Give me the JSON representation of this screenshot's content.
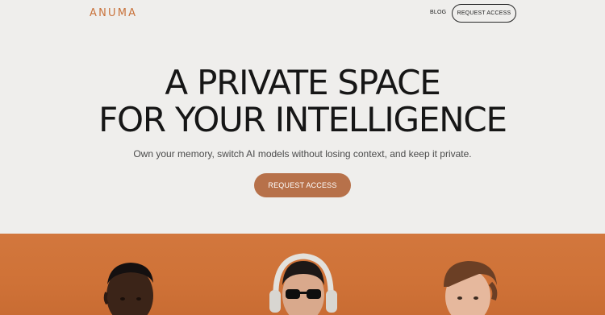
{
  "nav": {
    "logo": "ANUMA",
    "blog_label": "BLOG",
    "request_access_label": "REQUEST ACCESS"
  },
  "hero": {
    "title_line1": "A PRIVATE SPACE",
    "title_line2": "FOR YOUR INTELLIGENCE",
    "subtitle": "Own your memory, switch AI models without losing context, and keep it private.",
    "cta_label": "REQUEST ACCESS"
  },
  "colors": {
    "brand": "#c9733c",
    "cta_background": "#b7714a",
    "page_background": "#efeeec",
    "banner_background": "#d2773d"
  },
  "banner": {
    "people": [
      "person-left",
      "person-center-headphones",
      "person-right"
    ]
  }
}
